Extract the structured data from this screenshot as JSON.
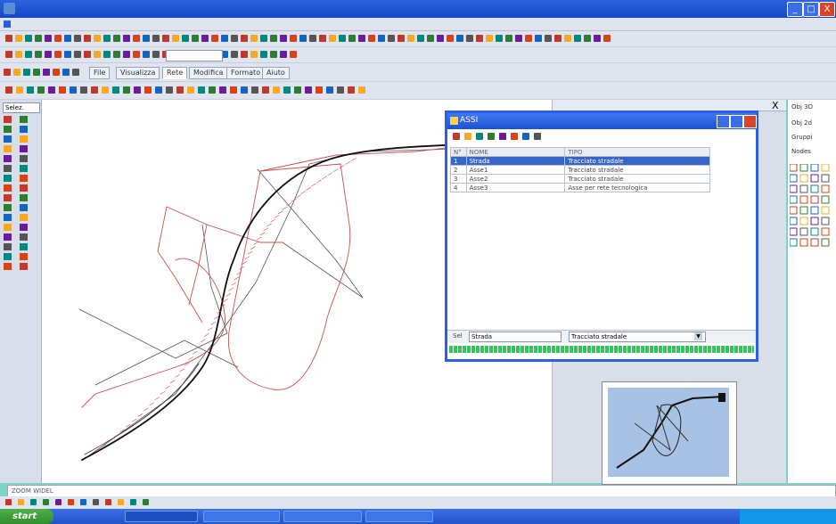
{
  "window": {
    "title": "",
    "buttons": [
      "_",
      "□",
      "X"
    ]
  },
  "tabs": [
    "File",
    "Visualizza",
    "Rete",
    "Modifica",
    "Formato",
    "Aiuto"
  ],
  "toolbar": {
    "dropdown_value": ""
  },
  "left_panel": {
    "label": "Selez."
  },
  "right_panel": {
    "close": "X"
  },
  "far_right": {
    "items": [
      "Obj 3D",
      "Obj 2d",
      "Gruppi",
      "Nodes"
    ]
  },
  "assi_dialog": {
    "title": "ASSI",
    "columns": [
      "N°",
      "NOME",
      "TIPO"
    ],
    "rows": [
      {
        "n": "1",
        "nome": "Strada",
        "tipo": "Tracciato stradale"
      },
      {
        "n": "2",
        "nome": "Asse1",
        "tipo": "Tracciato stradale"
      },
      {
        "n": "3",
        "nome": "Asse2",
        "tipo": "Tracciato stradale"
      },
      {
        "n": "4",
        "nome": "Asse3",
        "tipo": "Asse per rete tecnologica"
      }
    ],
    "footer": {
      "label": "Sel",
      "name": "Strada",
      "type": "Tracciato stradale"
    }
  },
  "command_line": {
    "text": "ZOOM WIDEL"
  },
  "status": {
    "coords": ""
  },
  "taskbar": {
    "start_label": "start",
    "clock": ""
  },
  "colors": {
    "accent": "#2a5ee6",
    "selected_row": "#3866c8",
    "road_outline": "#c85050"
  }
}
